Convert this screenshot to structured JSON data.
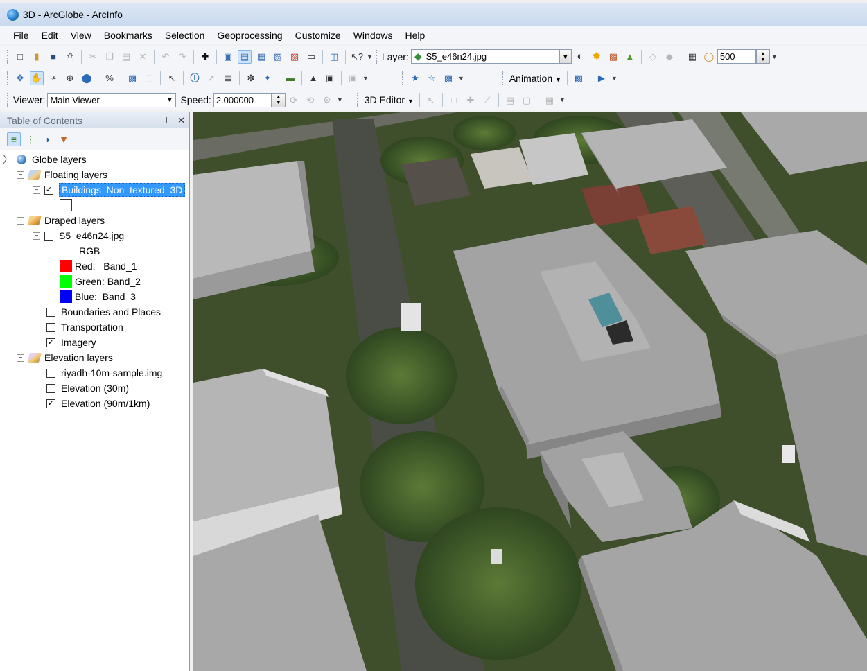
{
  "window": {
    "title": "3D - ArcGlobe - ArcInfo"
  },
  "menu": [
    "File",
    "Edit",
    "View",
    "Bookmarks",
    "Selection",
    "Geoprocessing",
    "Customize",
    "Windows",
    "Help"
  ],
  "toolbar1": {
    "layer_label": "Layer:",
    "layer_value": "S5_e46n24.jpg",
    "height_value": "500"
  },
  "toolbar2": {
    "animation_label": "Animation"
  },
  "toolbar3": {
    "viewer_label": "Viewer:",
    "viewer_value": "Main Viewer",
    "speed_label": "Speed:",
    "speed_value": "2.000000",
    "editor_label": "3D Editor"
  },
  "toc": {
    "title": "Table of Contents",
    "pin_glyph": "⊥",
    "close_glyph": "✕",
    "root": "Globe layers",
    "floating": "Floating layers",
    "buildings": "Buildings_Non_textured_3D",
    "draped": "Draped layers",
    "image_layer": "S5_e46n24.jpg",
    "rgb": "RGB",
    "red": "Red:   Band_1",
    "green": "Green: Band_2",
    "blue": "Blue:  Band_3",
    "boundaries": "Boundaries and Places",
    "transportation": "Transportation",
    "imagery": "Imagery",
    "elevation": "Elevation layers",
    "riyadh": "riyadh-10m-sample.img",
    "elev30": "Elevation (30m)",
    "elev90": "Elevation (90m/1km)"
  },
  "colors": {
    "selection": "#3399ff",
    "band_red": "#ff0000",
    "band_green": "#00ff00",
    "band_blue": "#0000ff"
  }
}
